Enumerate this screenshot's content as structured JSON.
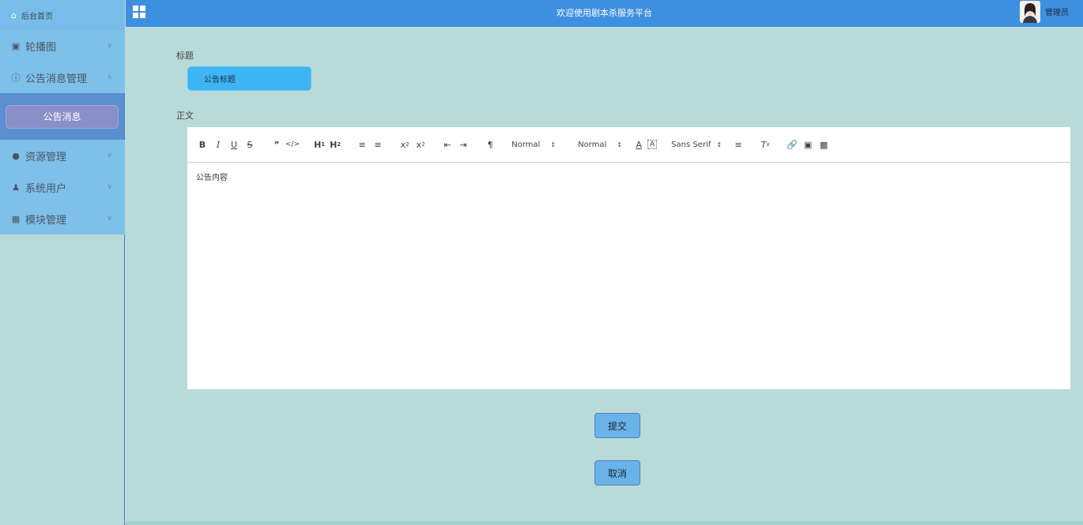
{
  "sidebar": {
    "home": "后台首页",
    "items": [
      {
        "label": "轮播图",
        "icon": "image-icon"
      },
      {
        "label": "公告消息管理",
        "icon": "info-circle-icon"
      },
      {
        "label": "资源管理",
        "icon": "pin-icon"
      },
      {
        "label": "系统用户",
        "icon": "user-icon"
      },
      {
        "label": "模块管理",
        "icon": "grid-icon"
      }
    ],
    "active_sub": "公告消息"
  },
  "header": {
    "title": "欢迎使用剧本杀服务平台",
    "user": "管理员"
  },
  "form": {
    "title_label": "标题",
    "title_value": "公告标题",
    "body_label": "正文",
    "body_value": "公告内容",
    "toolbar": {
      "size_select": "Normal",
      "header_select": "Normal",
      "font_select": "Sans Serif"
    },
    "submit": "提交",
    "cancel": "取消"
  },
  "colors": {
    "header": "#3d8fe0",
    "sidebar_top": "#7ec0e8",
    "submenu": "#5a8fd0",
    "background": "#b8dbd9",
    "title_input": "#3db5f5",
    "button": "#6ab3ea"
  }
}
